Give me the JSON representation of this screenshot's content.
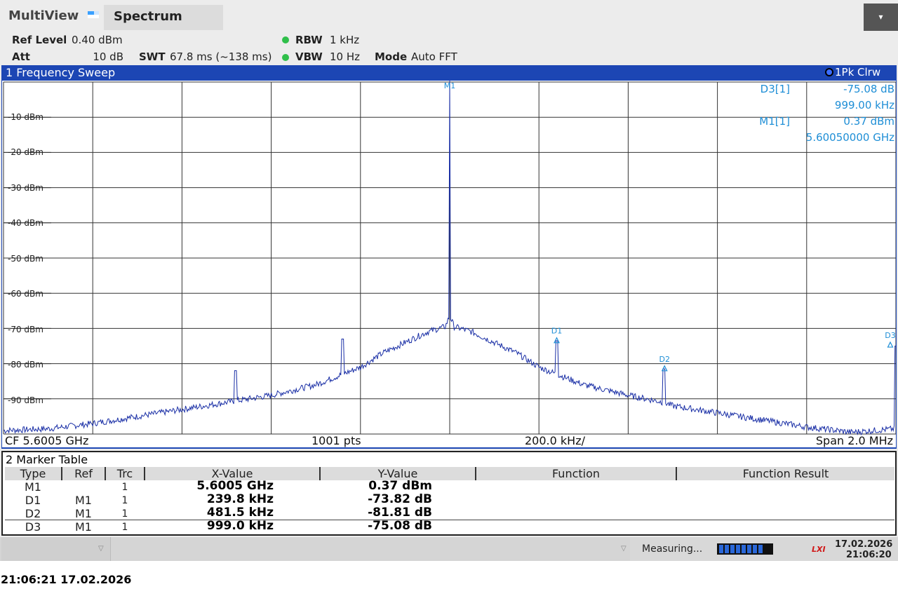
{
  "app": {
    "title": "MultiView",
    "tab": "Spectrum",
    "menu_icon": "caret-down-icon"
  },
  "settings": {
    "ref_level_label": "Ref Level",
    "ref_level_value": "0.40 dBm",
    "att_label": "Att",
    "att_value": "10 dB",
    "swt_label": "SWT",
    "swt_value": "67.8 ms (~138 ms)",
    "rbw_label": "RBW",
    "rbw_value": "1 kHz",
    "vbw_label": "VBW",
    "vbw_value": "10 Hz",
    "mode_label": "Mode",
    "mode_value": "Auto FFT"
  },
  "diagram": {
    "title": "1 Frequency Sweep",
    "trace_indicator": "1Pk Clrw",
    "y_labels": [
      "-10 dBm",
      "-20 dBm",
      "-30 dBm",
      "-40 dBm",
      "-50 dBm",
      "-60 dBm",
      "-70 dBm",
      "-80 dBm",
      "-90 dBm"
    ],
    "marker_labels": {
      "m1": "M1",
      "d1": "D1",
      "d2": "D2",
      "d3": "D3"
    },
    "readout": {
      "d3_label": "D3[1]",
      "d3_y": "-75.08 dB",
      "d3_x": "999.00 kHz",
      "m1_label": "M1[1]",
      "m1_y": "0.37 dBm",
      "m1_x": "5.60050000 GHz"
    },
    "footer": {
      "cf": "CF 5.6005 GHz",
      "pts": "1001 pts",
      "div": "200.0 kHz/",
      "span": "Span 2.0 MHz"
    }
  },
  "chart_data": {
    "type": "line",
    "y_unit": "dBm",
    "ylim": [
      -100,
      0
    ],
    "y_ticks": [
      -10,
      -20,
      -30,
      -40,
      -50,
      -60,
      -70,
      -80,
      -90
    ],
    "x_unit": "kHz offset from CF",
    "xlim": [
      -1000,
      1000
    ],
    "x_step": 200,
    "grid": true,
    "series": [
      {
        "x": [
          -1000,
          -900,
          -800,
          -700,
          -600,
          -500,
          -400,
          -300,
          -240,
          -200,
          -150,
          -100,
          -50,
          -10,
          -2,
          0,
          2,
          10,
          50,
          100,
          150,
          200,
          240,
          300,
          400,
          480,
          500,
          600,
          700,
          800,
          900,
          999
        ],
        "y": [
          -99,
          -98.5,
          -97,
          -95,
          -93,
          -91,
          -89,
          -86,
          -83,
          -81,
          -77,
          -74,
          -71,
          -69.5,
          -67,
          0.37,
          -67,
          -69.5,
          -71,
          -74,
          -77,
          -81,
          -83,
          -86,
          -89,
          -91,
          -92,
          -94,
          -96,
          -98,
          -99.5,
          -98.5
        ]
      }
    ],
    "spurs": [
      {
        "x": -480,
        "y": -82
      },
      {
        "x": -240,
        "y": -73
      },
      {
        "x": 240,
        "y": -73.5
      },
      {
        "x": 480,
        "y": -81.5
      },
      {
        "x": 999,
        "y": -75
      }
    ],
    "markers": [
      {
        "name": "M1",
        "x": 0,
        "y": 0.37
      },
      {
        "name": "D1",
        "x": 239.8,
        "y": -73.45
      },
      {
        "name": "D2",
        "x": 481.5,
        "y": -81.44
      },
      {
        "name": "D3",
        "x": 999,
        "y": -74.71
      }
    ],
    "trace_color": "#1a2fa6"
  },
  "marker_table": {
    "title": "2 Marker Table",
    "headers": [
      "Type",
      "Ref",
      "Trc",
      "X-Value",
      "Y-Value",
      "Function",
      "Function Result"
    ],
    "rows": [
      {
        "type": "M1",
        "ref": "",
        "trc": "1",
        "x": "5.6005 GHz",
        "y": "0.37 dBm"
      },
      {
        "type": "D1",
        "ref": "M1",
        "trc": "1",
        "x": "239.8 kHz",
        "y": "-73.82 dB"
      },
      {
        "type": "D2",
        "ref": "M1",
        "trc": "1",
        "x": "481.5 kHz",
        "y": "-81.81 dB"
      },
      {
        "type": "D3",
        "ref": "M1",
        "trc": "1",
        "x": "999.0 kHz",
        "y": "-75.08 dB"
      }
    ]
  },
  "status": {
    "measuring": "Measuring...",
    "progress": 0.85,
    "date": "17.02.2026",
    "time": "21:06:20"
  },
  "timestamp": "21:06:21  17.02.2026"
}
